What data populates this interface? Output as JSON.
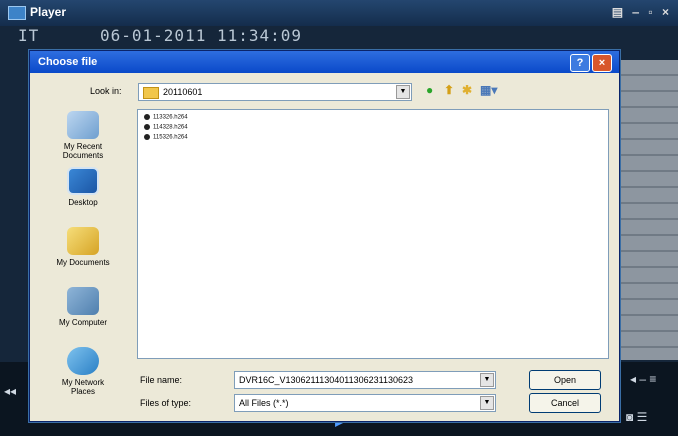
{
  "player": {
    "title": "Player",
    "window_controls": "▤ ‒ ▫ ×",
    "osd_left": "IT",
    "osd_timestamp": "06-01-2011 11:34:09"
  },
  "dialog": {
    "title": "Choose file",
    "help": "?",
    "close": "×",
    "look_in_label": "Look in:",
    "look_in_value": "20110601",
    "places": [
      {
        "label": "My Recent\nDocuments"
      },
      {
        "label": "Desktop"
      },
      {
        "label": "My Documents"
      },
      {
        "label": "My Computer"
      },
      {
        "label": "My Network\nPlaces"
      }
    ],
    "files": [
      "113326.h264",
      "114328.h264",
      "115326.h264"
    ],
    "file_name_label": "File name:",
    "file_name_value": "DVR16C_V13062111304011306231130623",
    "files_of_type_label": "Files of type:",
    "files_of_type_value": "All Files (*.*)",
    "open": "Open",
    "cancel": "Cancel"
  },
  "colors": {
    "accent": "#0a49c9",
    "close": "#d8572c",
    "folder": "#f1c64a"
  }
}
